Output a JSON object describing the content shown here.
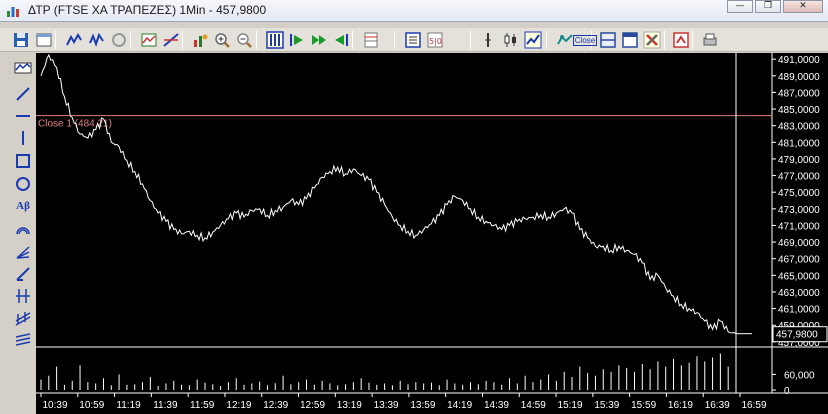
{
  "window": {
    "title": "ΔΤΡ (FTSE ΧΑ ΤΡΑΠΕΖΕΣ) 1Min - 457,9800",
    "buttons": {
      "minimize": "—",
      "restore": "❐",
      "close": "✕"
    }
  },
  "toolbar": {
    "icons": [
      "save-icon",
      "window-icon",
      "chart-style-icon",
      "chart-style2-icon",
      "refresh-icon",
      "indicator-icon",
      "trendline-icon",
      "objects-icon",
      "zoom-in-icon",
      "zoom-out-icon",
      "bars-icon",
      "play-icon",
      "play-forward-icon",
      "play-back-icon",
      "grid-icon",
      "list-icon",
      "data-icon",
      "vertical-line-icon",
      "candle-icon",
      "line-chart-icon",
      "compare-icon",
      "close-label-icon",
      "panel-icon",
      "window2-icon",
      "tools-icon",
      "export-icon",
      "print-icon"
    ],
    "close_label": "Close"
  },
  "left_tools": {
    "icons": [
      "chart-type-icon",
      "diagonal-line-icon",
      "horizontal-line-icon",
      "vertical-line-icon",
      "rectangle-icon",
      "ellipse-icon",
      "text-icon",
      "arc-icon",
      "fan-icon",
      "pen-icon",
      "fibonacci-icon",
      "channel-icon",
      "gann-icon"
    ],
    "text_tool_label": "Aβ"
  },
  "chart_data": {
    "type": "line",
    "x_tick_labels": [
      "10:39",
      "10:59",
      "11:19",
      "11:39",
      "11:59",
      "12:19",
      "12:39",
      "12:59",
      "13:19",
      "13:39",
      "13:59",
      "14:19",
      "14:39",
      "14:59",
      "15:19",
      "15:39",
      "15:59",
      "16:19",
      "16:39",
      "16:59"
    ],
    "y_tick_labels": [
      "491,0000",
      "489,0000",
      "487,0000",
      "485,0000",
      "483,0000",
      "481,0000",
      "479,0000",
      "477,0000",
      "475,0000",
      "473,0000",
      "471,0000",
      "469,0000",
      "467,0000",
      "465,0000",
      "463,0000",
      "461,0000",
      "459,0000",
      "457,0000"
    ],
    "ylim": [
      456.5,
      491.5
    ],
    "last_value_label": "457,9800",
    "last_value": 457.98,
    "reference_line": {
      "label": "Close 1 (484,21)",
      "value": 484.21,
      "color": "#e08080"
    },
    "series": [
      {
        "values": [
          489.0,
          491.5,
          490.0,
          486.5,
          484.0,
          482.0,
          481.5,
          482.5,
          483.8,
          481.0,
          480.5,
          478.8,
          477.5,
          476.0,
          474.0,
          472.5,
          471.5,
          470.5,
          470.0,
          470.3,
          469.8,
          469.5,
          470.2,
          471.0,
          471.8,
          472.5,
          472.0,
          472.8,
          473.0,
          472.2,
          472.8,
          473.2,
          474.0,
          473.5,
          474.2,
          475.5,
          476.8,
          477.5,
          478.0,
          477.2,
          477.8,
          477.0,
          476.5,
          475.0,
          473.5,
          472.0,
          471.0,
          470.3,
          469.8,
          470.5,
          471.2,
          472.2,
          473.5,
          474.5,
          474.0,
          473.0,
          472.0,
          471.5,
          471.0,
          470.5,
          471.0,
          471.5,
          471.8,
          472.0,
          472.3,
          472.0,
          472.5,
          473.0,
          472.5,
          470.5,
          469.5,
          468.5,
          468.5,
          468.0,
          468.5,
          468.0,
          467.5,
          466.5,
          464.5,
          465.0,
          463.5,
          462.5,
          461.5,
          461.0,
          460.5,
          459.5,
          458.5,
          459.5,
          458.2,
          457.98
        ]
      }
    ],
    "volume": {
      "tick_labels": [
        "60,000",
        "0"
      ],
      "ylim": [
        0,
        150
      ],
      "values": [
        40,
        55,
        90,
        20,
        35,
        95,
        30,
        25,
        45,
        18,
        60,
        20,
        22,
        30,
        50,
        15,
        25,
        35,
        20,
        18,
        40,
        28,
        22,
        15,
        30,
        45,
        20,
        25,
        32,
        18,
        26,
        55,
        22,
        30,
        40,
        20,
        35,
        25,
        18,
        22,
        30,
        45,
        28,
        20,
        25,
        18,
        35,
        22,
        30,
        25,
        28,
        18,
        40,
        25,
        20,
        30,
        22,
        35,
        30,
        20,
        45,
        25,
        55,
        30,
        40,
        60,
        35,
        70,
        50,
        90,
        65,
        55,
        80,
        70,
        95,
        85,
        70,
        100,
        80,
        110,
        90,
        120,
        95,
        105,
        130,
        110,
        125,
        140,
        90,
        20
      ]
    }
  }
}
